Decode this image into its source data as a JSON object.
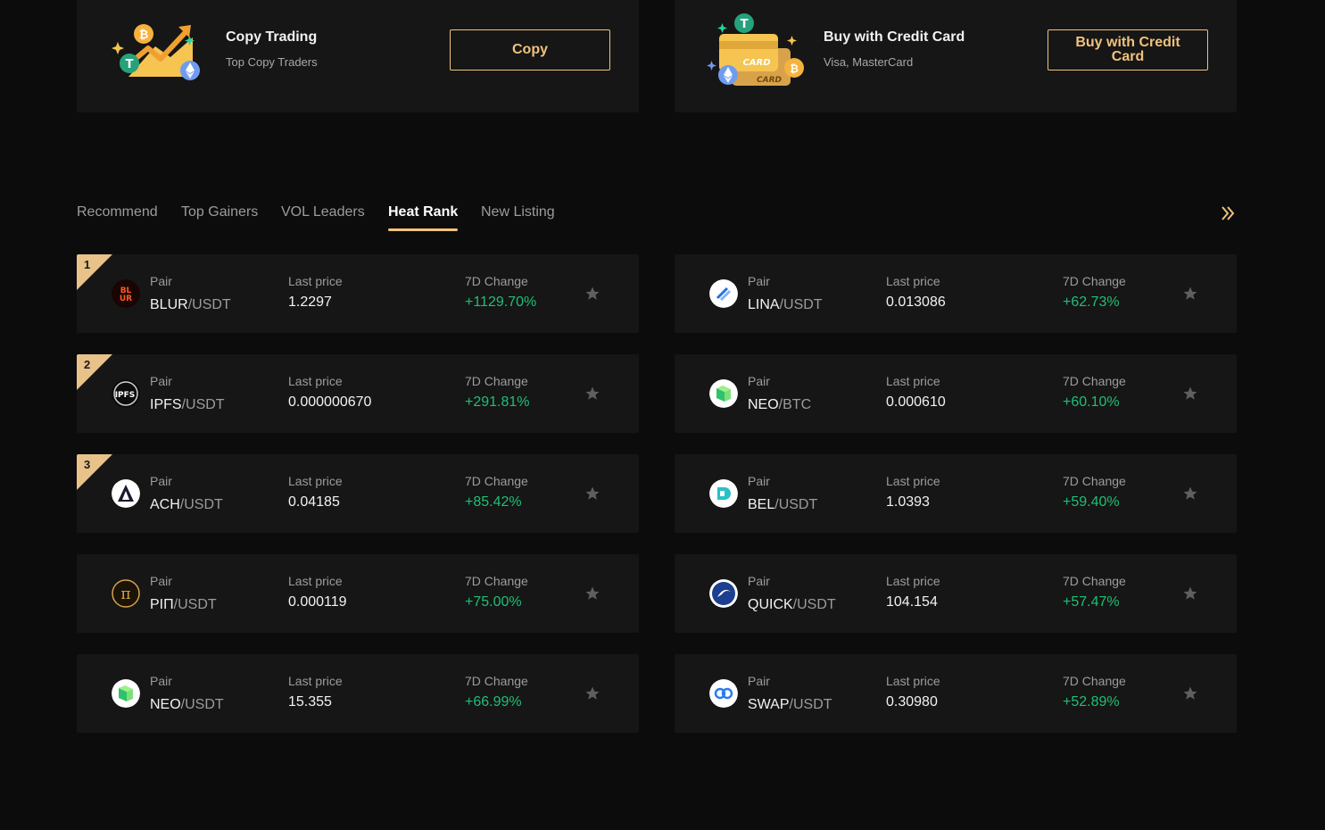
{
  "promos": [
    {
      "title": "Copy Trading",
      "subtitle": "Top Copy Traders",
      "button": "Copy"
    },
    {
      "title": "Buy with Credit Card",
      "subtitle": "Visa, MasterCard",
      "button": "Buy with Credit Card",
      "art_text": [
        "CARD",
        "CARD"
      ]
    }
  ],
  "tabs": [
    "Recommend",
    "Top Gainers",
    "VOL Leaders",
    "Heat Rank",
    "New Listing"
  ],
  "active_tab": "Heat Rank",
  "labels": {
    "pair": "Pair",
    "last_price": "Last price",
    "change": "7D Change"
  },
  "rows": [
    {
      "rank": "1",
      "base": "BLUR",
      "quote": "/USDT",
      "price": "1.2297",
      "change": "+1129.70%",
      "icon": "blur-icon"
    },
    {
      "rank": "2",
      "base": "IPFS",
      "quote": "/USDT",
      "price": "0.000000670",
      "change": "+291.81%",
      "icon": "ipfs-icon"
    },
    {
      "rank": "3",
      "base": "ACH",
      "quote": "/USDT",
      "price": "0.04185",
      "change": "+85.42%",
      "icon": "ach-icon"
    },
    {
      "rank": "",
      "base": "PIΠ",
      "quote": "/USDT",
      "price": "0.000119",
      "change": "+75.00%",
      "icon": "pi-icon"
    },
    {
      "rank": "",
      "base": "NEO",
      "quote": "/USDT",
      "price": "15.355",
      "change": "+66.99%",
      "icon": "neo-icon"
    },
    {
      "rank": "",
      "base": "LINA",
      "quote": "/USDT",
      "price": "0.013086",
      "change": "+62.73%",
      "icon": "lina-icon"
    },
    {
      "rank": "",
      "base": "NEO",
      "quote": "/BTC",
      "price": "0.000610",
      "change": "+60.10%",
      "icon": "neo-icon"
    },
    {
      "rank": "",
      "base": "BEL",
      "quote": "/USDT",
      "price": "1.0393",
      "change": "+59.40%",
      "icon": "bel-icon"
    },
    {
      "rank": "",
      "base": "QUICK",
      "quote": "/USDT",
      "price": "104.154",
      "change": "+57.47%",
      "icon": "quick-icon"
    },
    {
      "rank": "",
      "base": "SWAP",
      "quote": "/USDT",
      "price": "0.30980",
      "change": "+52.89%",
      "icon": "swap-icon"
    }
  ],
  "colors": {
    "accent": "#f0c27b",
    "positive": "#1fbf75",
    "card_bg": "#161616",
    "page_bg": "#0c0c0c"
  }
}
